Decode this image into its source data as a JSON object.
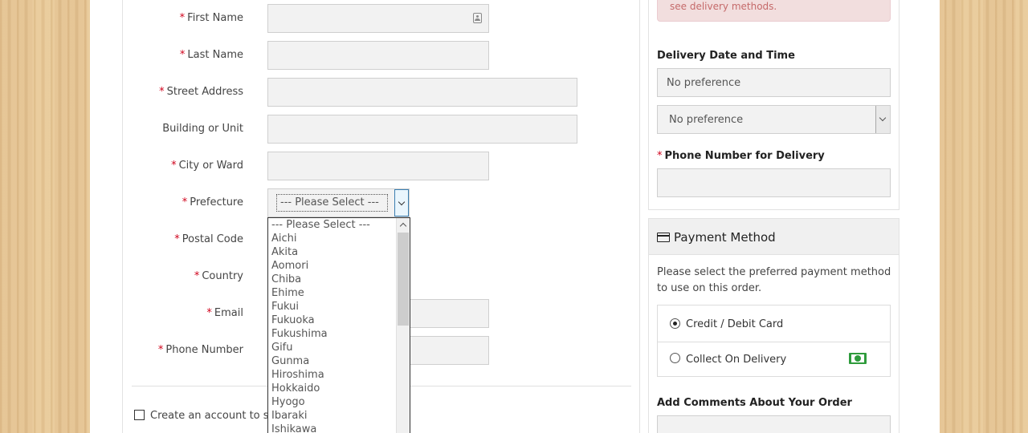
{
  "address_form": {
    "fields": [
      {
        "label": "First Name",
        "required": true
      },
      {
        "label": "Last Name",
        "required": true
      },
      {
        "label": "Street Address",
        "required": true
      },
      {
        "label": "Building or Unit",
        "required": false
      },
      {
        "label": "City or Ward",
        "required": true
      },
      {
        "label": "Prefecture",
        "required": true
      },
      {
        "label": "Postal Code",
        "required": true
      },
      {
        "label": "Country",
        "required": true
      },
      {
        "label": "Email",
        "required": true
      },
      {
        "label": "Phone Number",
        "required": true
      }
    ],
    "required_marker": "*",
    "prefecture_select": {
      "selected": "--- Please Select ---",
      "options": [
        "--- Please Select ---",
        "Aichi",
        "Akita",
        "Aomori",
        "Chiba",
        "Ehime",
        "Fukui",
        "Fukuoka",
        "Fukushima",
        "Gifu",
        "Gunma",
        "Hiroshima",
        "Hokkaido",
        "Hyogo",
        "Ibaraki",
        "Ishikawa"
      ]
    },
    "create_account_label": "Create an account to sav"
  },
  "delivery": {
    "alert_text": "see delivery methods.",
    "date_time_heading": "Delivery Date and Time",
    "date_value": "No preference",
    "time_value": "No preference",
    "phone_heading": "Phone Number for Delivery"
  },
  "payment": {
    "title": "Payment Method",
    "description": "Please select the preferred payment method to use on this order.",
    "options": [
      {
        "label": "Credit / Debit Card",
        "checked": true
      },
      {
        "label": "Collect On Delivery",
        "checked": false
      }
    ],
    "comments_heading": "Add Comments About Your Order"
  },
  "colors": {
    "required": "#d0021b",
    "alert_bg": "#f2dede",
    "alert_text": "#c56a6a",
    "cash_icon": "#2e9b3c",
    "focus_border": "#3c7fb1"
  }
}
